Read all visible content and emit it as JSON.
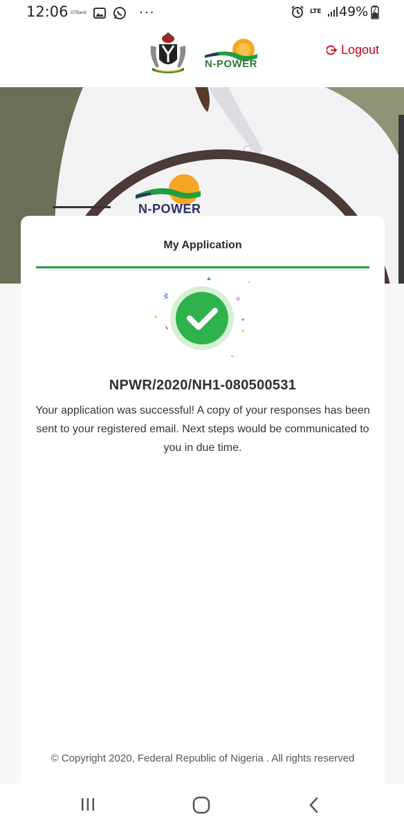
{
  "status_bar": {
    "time": "12:06",
    "bank_label": "GTBank",
    "network": "LTE",
    "battery": "49%"
  },
  "header": {
    "logo_text": "N-POWER",
    "logout_label": "Logout"
  },
  "hero": {
    "sign_text": "N-POWER"
  },
  "card": {
    "title": "My Application",
    "application_number": "NPWR/2020/NH1-080500531",
    "message": "Your application was successful! A copy of your responses has been sent to your registered email. Next steps would be communicated to you in due time.",
    "copyright": "© Copyright 2020, Federal Republic of Nigeria . All rights reserved"
  },
  "colors": {
    "accent_green": "#1f9e3e",
    "logout_red": "#d0021b"
  },
  "icons": [
    "alarm-icon",
    "signal-icon",
    "battery-icon",
    "logout-icon",
    "check-icon",
    "recent-apps-icon",
    "home-icon",
    "back-icon"
  ]
}
